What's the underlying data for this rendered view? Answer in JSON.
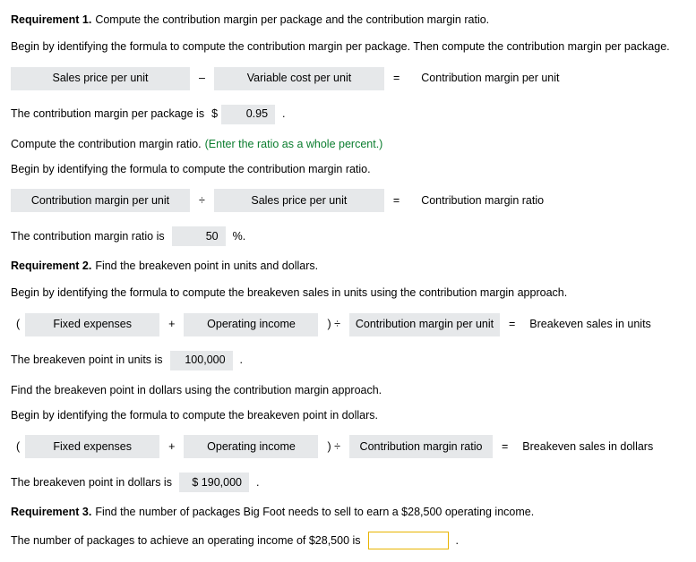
{
  "r1": {
    "heading_label": "Requirement 1.",
    "heading_text": "Compute the contribution margin per package and the contribution margin ratio.",
    "intro": "Begin by identifying the formula to compute the contribution margin per package. Then compute the contribution margin per package.",
    "formula": {
      "a": "Sales price per unit",
      "op": "–",
      "b": "Variable cost per unit",
      "eq": "=",
      "result": "Contribution margin per unit"
    },
    "value_label_pre": "The contribution margin per package is",
    "value_prefix": "$",
    "value": "0.95",
    "value_suffix": ".",
    "ratio_intro1": "Compute the contribution margin ratio.",
    "ratio_hint": "(Enter the ratio as a whole percent.)",
    "ratio_intro2": "Begin by identifying the formula to compute the contribution margin ratio.",
    "ratio_formula": {
      "a": "Contribution margin per unit",
      "op": "÷",
      "b": "Sales price per unit",
      "eq": "=",
      "result": "Contribution margin ratio"
    },
    "ratio_value_label_pre": "The contribution margin ratio is",
    "ratio_value": "50",
    "ratio_value_suffix": "%."
  },
  "r2": {
    "heading_label": "Requirement 2.",
    "heading_text": "Find the breakeven point in units and dollars.",
    "units_intro": "Begin by identifying the formula to compute the breakeven sales in units using the contribution margin approach.",
    "units_formula": {
      "open": "(",
      "a": "Fixed expenses",
      "op1": "+",
      "b": "Operating income",
      "close": ") ÷",
      "c": "Contribution margin per unit",
      "eq": "=",
      "result": "Breakeven sales in units"
    },
    "units_value_label_pre": "The breakeven point in units is",
    "units_value": "100,000",
    "units_value_suffix": ".",
    "dollars_intro1": "Find the breakeven point in dollars using the contribution margin approach.",
    "dollars_intro2": "Begin by identifying the formula to compute the breakeven point in dollars.",
    "dollars_formula": {
      "open": "(",
      "a": "Fixed expenses",
      "op1": "+",
      "b": "Operating income",
      "close": ") ÷",
      "c": "Contribution margin ratio",
      "eq": "=",
      "result": "Breakeven sales in dollars"
    },
    "dollars_value_label_pre": "The breakeven point in dollars is",
    "dollars_value": "$ 190,000",
    "dollars_value_suffix": "."
  },
  "r3": {
    "heading_label": "Requirement 3.",
    "heading_text": "Find the number of packages Big Foot needs to sell to earn a $28,500 operating income.",
    "value_label_pre": "The number of packages to achieve an operating income of $28,500 is",
    "value_suffix": "."
  }
}
